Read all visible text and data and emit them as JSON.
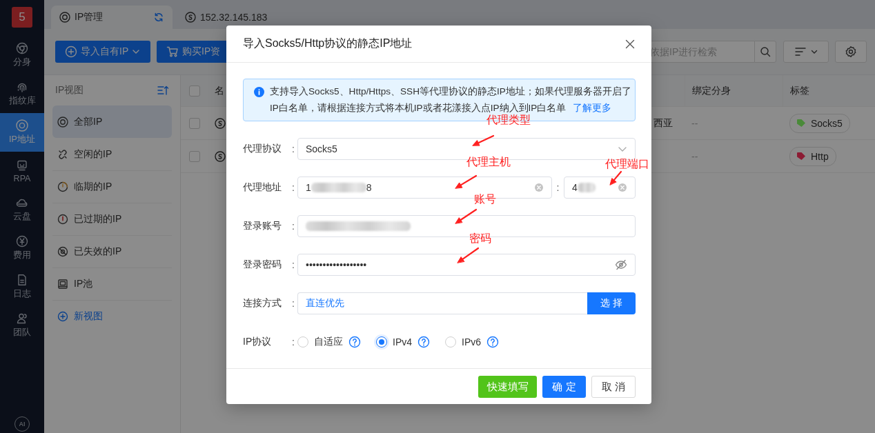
{
  "rail": {
    "logo": "5",
    "items": [
      {
        "label": "分身",
        "selected": false
      },
      {
        "label": "指纹库",
        "selected": false
      },
      {
        "label": "IP地址",
        "selected": true
      },
      {
        "label": "RPA",
        "selected": false
      },
      {
        "label": "云盘",
        "selected": false
      },
      {
        "label": "费用",
        "selected": false
      },
      {
        "label": "日志",
        "selected": false
      },
      {
        "label": "团队",
        "selected": false
      }
    ],
    "ai_button": "AI"
  },
  "tabs": [
    {
      "label": "IP管理",
      "selected": true
    },
    {
      "label": "152.32.145.183",
      "selected": false
    }
  ],
  "toolbar": {
    "import_button": "导入自有IP",
    "buy_button": "购买IP资",
    "search": {
      "placeholder": "依据IP进行检索"
    }
  },
  "view_panel": {
    "title": "IP视图",
    "items": [
      {
        "label": "全部IP",
        "selected": true
      },
      {
        "label": "空闲的IP",
        "selected": false
      },
      {
        "label": "临期的IP",
        "selected": false
      },
      {
        "label": "已过期的IP",
        "selected": false
      },
      {
        "label": "已失效的IP",
        "selected": false
      },
      {
        "label": "IP池",
        "selected": false
      }
    ],
    "add_view": "新视图"
  },
  "table": {
    "all_checked": false,
    "columns": [
      "名",
      "绑定分身",
      "标签"
    ],
    "rows": [
      {
        "checked": false,
        "location": "西亚",
        "bound": "--",
        "tag": {
          "label": "Socks5",
          "color": "#4a8a3a"
        }
      },
      {
        "checked": false,
        "bound": "--",
        "tag": {
          "label": "Http",
          "color": "#8c1c34"
        }
      }
    ]
  },
  "dialog": {
    "title": "导入Socks5/Http协议的静态IP地址",
    "notice": {
      "text": "支持导入Socks5、Http/Https、SSH等代理协议的静态IP地址；如果代理服务器开启了IP白名单，请根据连接方式将本机IP或者花漾接入点IP纳入到IP白名单",
      "link": "了解更多"
    },
    "fields": [
      {
        "kind": "select",
        "label": "代理协议",
        "separator": ":",
        "value": "Socks5"
      },
      {
        "kind": "address",
        "label": "代理地址",
        "separator": ":",
        "host_start": "1",
        "host_end": "8",
        "port_separator": ":",
        "port_start": "4"
      },
      {
        "kind": "blurred",
        "label": "登录账号",
        "separator": ":"
      },
      {
        "kind": "password",
        "label": "登录密码",
        "separator": ":",
        "value": "••••••••••••••••••"
      },
      {
        "kind": "picker",
        "label": "连接方式",
        "separator": ":",
        "value": "直连优先",
        "button": "选 择"
      },
      {
        "kind": "radios",
        "label": "IP协议",
        "separator": ":",
        "options": [
          {
            "label": "自适应",
            "selected": false
          },
          {
            "label": "IPv4",
            "selected": true
          },
          {
            "label": "IPv6",
            "selected": false
          }
        ]
      }
    ],
    "buttons": [
      {
        "kind": "quick",
        "label": "快速填写"
      },
      {
        "kind": "primary",
        "label": "确 定"
      },
      {
        "kind": "default",
        "label": "取 消"
      }
    ],
    "annotations": [
      {
        "text": "代理类型"
      },
      {
        "text": "代理主机"
      },
      {
        "text": "代理端口"
      },
      {
        "text": "账号"
      },
      {
        "text": "密码"
      }
    ]
  }
}
